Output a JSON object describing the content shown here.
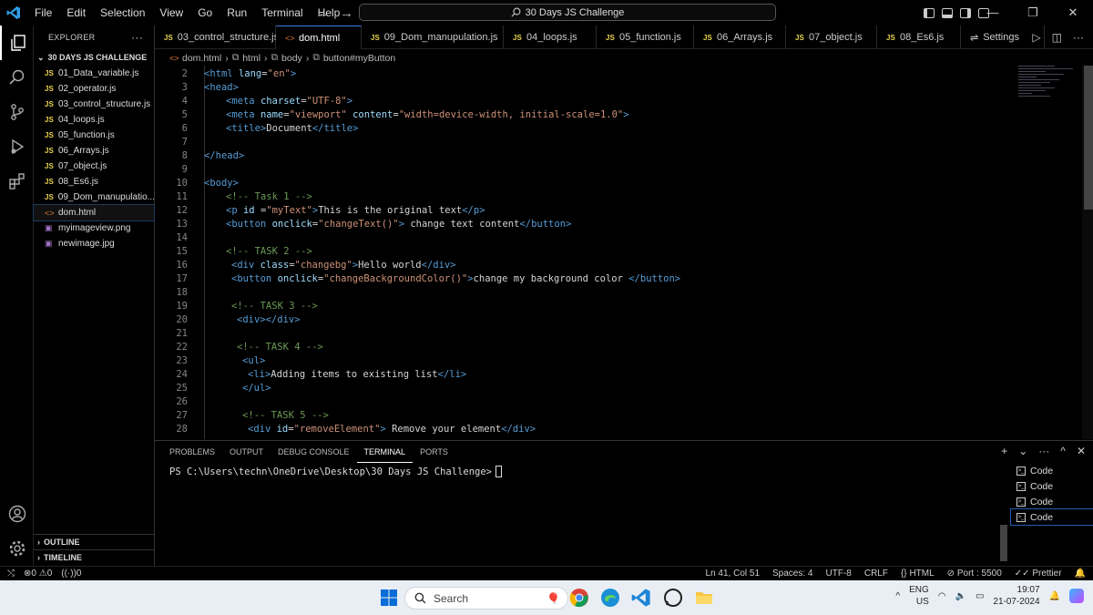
{
  "menu": [
    "File",
    "Edit",
    "Selection",
    "View",
    "Go",
    "Run",
    "Terminal",
    "Help"
  ],
  "command_center": "30 Days JS Challenge",
  "window_controls": [
    "—",
    "❐",
    "✕"
  ],
  "explorer": {
    "title": "EXPLORER",
    "more": "···",
    "folder": "30 DAYS JS CHALLENGE",
    "files": [
      {
        "badge": "JS",
        "name": "01_Data_variable.js",
        "type": "js"
      },
      {
        "badge": "JS",
        "name": "02_operator.js",
        "type": "js"
      },
      {
        "badge": "JS",
        "name": "03_control_structure.js",
        "type": "js"
      },
      {
        "badge": "JS",
        "name": "04_loops.js",
        "type": "js"
      },
      {
        "badge": "JS",
        "name": "05_function.js",
        "type": "js"
      },
      {
        "badge": "JS",
        "name": "06_Arrays.js",
        "type": "js"
      },
      {
        "badge": "JS",
        "name": "07_object.js",
        "type": "js"
      },
      {
        "badge": "JS",
        "name": "08_Es6.js",
        "type": "js"
      },
      {
        "badge": "JS",
        "name": "09_Dom_manupulatio...",
        "type": "js"
      },
      {
        "badge": "<>",
        "name": "dom.html",
        "type": "html"
      },
      {
        "badge": "▣",
        "name": "myimageview.png",
        "type": "img"
      },
      {
        "badge": "▣",
        "name": "newimage.jpg",
        "type": "img"
      }
    ],
    "outline": "OUTLINE",
    "timeline": "TIMELINE"
  },
  "tabs": [
    {
      "badge": "JS",
      "label": "03_control_structure.js",
      "type": "js",
      "width": 133
    },
    {
      "badge": "<>",
      "label": "dom.html",
      "type": "html",
      "width": 94,
      "active": true
    },
    {
      "badge": "JS",
      "label": "09_Dom_manupulation.js",
      "type": "js",
      "width": 156
    },
    {
      "badge": "JS",
      "label": "04_loops.js",
      "type": "js",
      "width": 102
    },
    {
      "badge": "JS",
      "label": "05_function.js",
      "type": "js",
      "width": 107
    },
    {
      "badge": "JS",
      "label": "06_Arrays.js",
      "type": "js",
      "width": 101
    },
    {
      "badge": "JS",
      "label": "07_object.js",
      "type": "js",
      "width": 100
    },
    {
      "badge": "JS",
      "label": "08_Es6.js",
      "type": "js",
      "width": 92
    },
    {
      "badge": "⇌",
      "label": "Settings",
      "type": "settings",
      "width": 92
    }
  ],
  "breadcrumb": [
    "dom.html",
    "html",
    "body",
    "button#myButton"
  ],
  "code_lines": [
    {
      "n": "2",
      "indent": 0,
      "parts": [
        [
          "tg",
          "<html "
        ],
        [
          "at",
          "lang"
        ],
        [
          "tx",
          "="
        ],
        [
          "st",
          "\"en\""
        ],
        [
          "tg",
          ">"
        ]
      ]
    },
    {
      "n": "3",
      "indent": 0,
      "parts": [
        [
          "tg",
          "<head>"
        ]
      ]
    },
    {
      "n": "4",
      "indent": 4,
      "parts": [
        [
          "tg",
          "<meta "
        ],
        [
          "at",
          "charset"
        ],
        [
          "tx",
          "="
        ],
        [
          "st",
          "\"UTF-8\""
        ],
        [
          "tg",
          ">"
        ]
      ]
    },
    {
      "n": "5",
      "indent": 4,
      "parts": [
        [
          "tg",
          "<meta "
        ],
        [
          "at",
          "name"
        ],
        [
          "tx",
          "="
        ],
        [
          "st",
          "\"viewport\""
        ],
        [
          "tx",
          " "
        ],
        [
          "at",
          "content"
        ],
        [
          "tx",
          "="
        ],
        [
          "st",
          "\"width=device-width, initial-scale=1.0\""
        ],
        [
          "tg",
          ">"
        ]
      ]
    },
    {
      "n": "6",
      "indent": 4,
      "parts": [
        [
          "tg",
          "<title>"
        ],
        [
          "tx",
          "Document"
        ],
        [
          "tg",
          "</title>"
        ]
      ]
    },
    {
      "n": "7",
      "indent": 0,
      "parts": []
    },
    {
      "n": "8",
      "indent": 0,
      "parts": [
        [
          "tg",
          "</head>"
        ]
      ]
    },
    {
      "n": "9",
      "indent": 0,
      "parts": []
    },
    {
      "n": "10",
      "indent": 0,
      "parts": [
        [
          "tg",
          "<body>"
        ]
      ]
    },
    {
      "n": "11",
      "indent": 4,
      "parts": [
        [
          "cm",
          "<!-- Task 1 -->"
        ]
      ]
    },
    {
      "n": "12",
      "indent": 4,
      "parts": [
        [
          "tg",
          "<p "
        ],
        [
          "at",
          "id"
        ],
        [
          "tx",
          " ="
        ],
        [
          "st",
          "\"myText\""
        ],
        [
          "tg",
          ">"
        ],
        [
          "tx",
          "This is the original text"
        ],
        [
          "tg",
          "</p>"
        ]
      ]
    },
    {
      "n": "13",
      "indent": 4,
      "parts": [
        [
          "tg",
          "<button "
        ],
        [
          "at",
          "onclick"
        ],
        [
          "tx",
          "="
        ],
        [
          "st",
          "\"changeText()\""
        ],
        [
          "tg",
          ">"
        ],
        [
          "tx",
          " change text content"
        ],
        [
          "tg",
          "</button>"
        ]
      ]
    },
    {
      "n": "14",
      "indent": 0,
      "parts": []
    },
    {
      "n": "15",
      "indent": 4,
      "parts": [
        [
          "cm",
          "<!-- TASK 2 -->"
        ]
      ]
    },
    {
      "n": "16",
      "indent": 5,
      "parts": [
        [
          "tg",
          "<div "
        ],
        [
          "at",
          "class"
        ],
        [
          "tx",
          "="
        ],
        [
          "st",
          "\"changebg\""
        ],
        [
          "tg",
          ">"
        ],
        [
          "tx",
          "Hello world"
        ],
        [
          "tg",
          "</div>"
        ]
      ]
    },
    {
      "n": "17",
      "indent": 5,
      "parts": [
        [
          "tg",
          "<button "
        ],
        [
          "at",
          "onclick"
        ],
        [
          "tx",
          "="
        ],
        [
          "st",
          "\"changeBackgroundColor()\""
        ],
        [
          "tg",
          ">"
        ],
        [
          "tx",
          "change my background color "
        ],
        [
          "tg",
          "</button>"
        ]
      ]
    },
    {
      "n": "18",
      "indent": 0,
      "parts": []
    },
    {
      "n": "19",
      "indent": 5,
      "parts": [
        [
          "cm",
          "<!-- TASK 3 -->"
        ]
      ]
    },
    {
      "n": "20",
      "indent": 6,
      "parts": [
        [
          "tg",
          "<div></div>"
        ]
      ]
    },
    {
      "n": "21",
      "indent": 0,
      "parts": []
    },
    {
      "n": "22",
      "indent": 6,
      "parts": [
        [
          "cm",
          "<!-- TASK 4 -->"
        ]
      ]
    },
    {
      "n": "23",
      "indent": 7,
      "parts": [
        [
          "tg",
          "<ul>"
        ]
      ]
    },
    {
      "n": "24",
      "indent": 8,
      "parts": [
        [
          "tg",
          "<li>"
        ],
        [
          "tx",
          "Adding items to existing list"
        ],
        [
          "tg",
          "</li>"
        ]
      ]
    },
    {
      "n": "25",
      "indent": 7,
      "parts": [
        [
          "tg",
          "</ul>"
        ]
      ]
    },
    {
      "n": "26",
      "indent": 0,
      "parts": []
    },
    {
      "n": "27",
      "indent": 7,
      "parts": [
        [
          "cm",
          "<!-- TASK 5 -->"
        ]
      ]
    },
    {
      "n": "28",
      "indent": 8,
      "parts": [
        [
          "tg",
          "<div "
        ],
        [
          "at",
          "id"
        ],
        [
          "tx",
          "="
        ],
        [
          "st",
          "\"removeElement\""
        ],
        [
          "tg",
          ">"
        ],
        [
          "tx",
          " Remove your element"
        ],
        [
          "tg",
          "</div>"
        ]
      ]
    }
  ],
  "panel": {
    "tabs": [
      "PROBLEMS",
      "OUTPUT",
      "DEBUG CONSOLE",
      "TERMINAL",
      "PORTS"
    ],
    "active_tab": "TERMINAL",
    "prompt": "PS C:\\Users\\techn\\OneDrive\\Desktop\\30 Days JS Challenge>",
    "terminals": [
      "Code",
      "Code",
      "Code",
      "Code"
    ],
    "actions": [
      "+",
      "⌄",
      "···",
      "^",
      "✕"
    ]
  },
  "status": {
    "remote": "⚡",
    "errors": "0",
    "warnings": "0",
    "ports": "0",
    "position": "Ln 41, Col 51",
    "spaces": "Spaces: 4",
    "encoding": "UTF-8",
    "eol": "CRLF",
    "language": "HTML",
    "port": "Port : 5500",
    "formatter": "Prettier"
  },
  "taskbar": {
    "search": "Search",
    "lang_top": "ENG",
    "lang_bottom": "US",
    "time": "19:07",
    "date": "21-07-2024"
  }
}
